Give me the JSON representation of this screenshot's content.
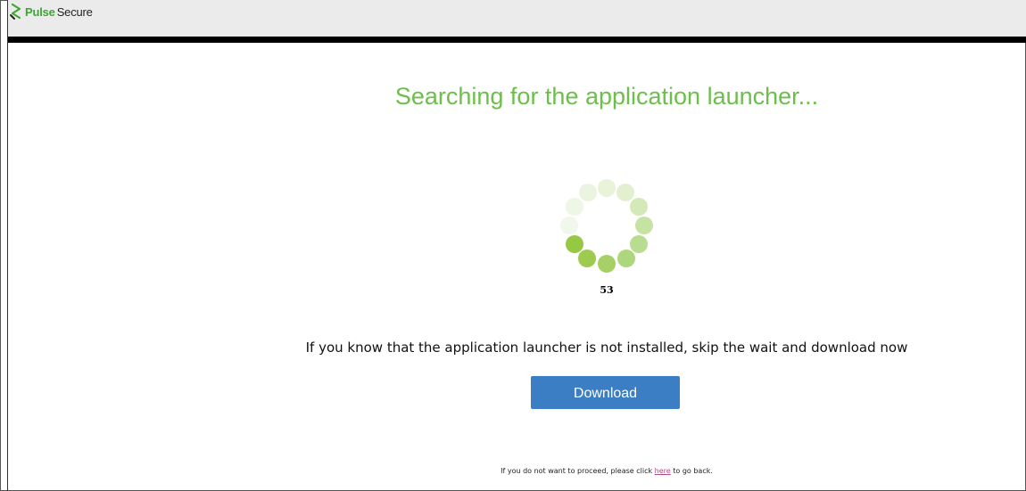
{
  "header": {
    "logo_brand": "Pulse",
    "logo_product": "Secure",
    "logo_icon": "pulse-secure-logo-icon"
  },
  "main": {
    "title": "Searching for the application launcher...",
    "countdown": "53",
    "spinner_icon": "loading-spinner-icon",
    "info_text": "If you know that the application launcher is not installed, skip the wait and download now",
    "download_label": "Download"
  },
  "footer": {
    "text_before": "If you do not want to proceed, please click ",
    "link_text": "here",
    "text_after": " to go back."
  },
  "colors": {
    "brand_green": "#6cbf4b",
    "button_blue": "#3c7ec4",
    "link": "#b04a86",
    "header_bg": "#ebebeb"
  }
}
